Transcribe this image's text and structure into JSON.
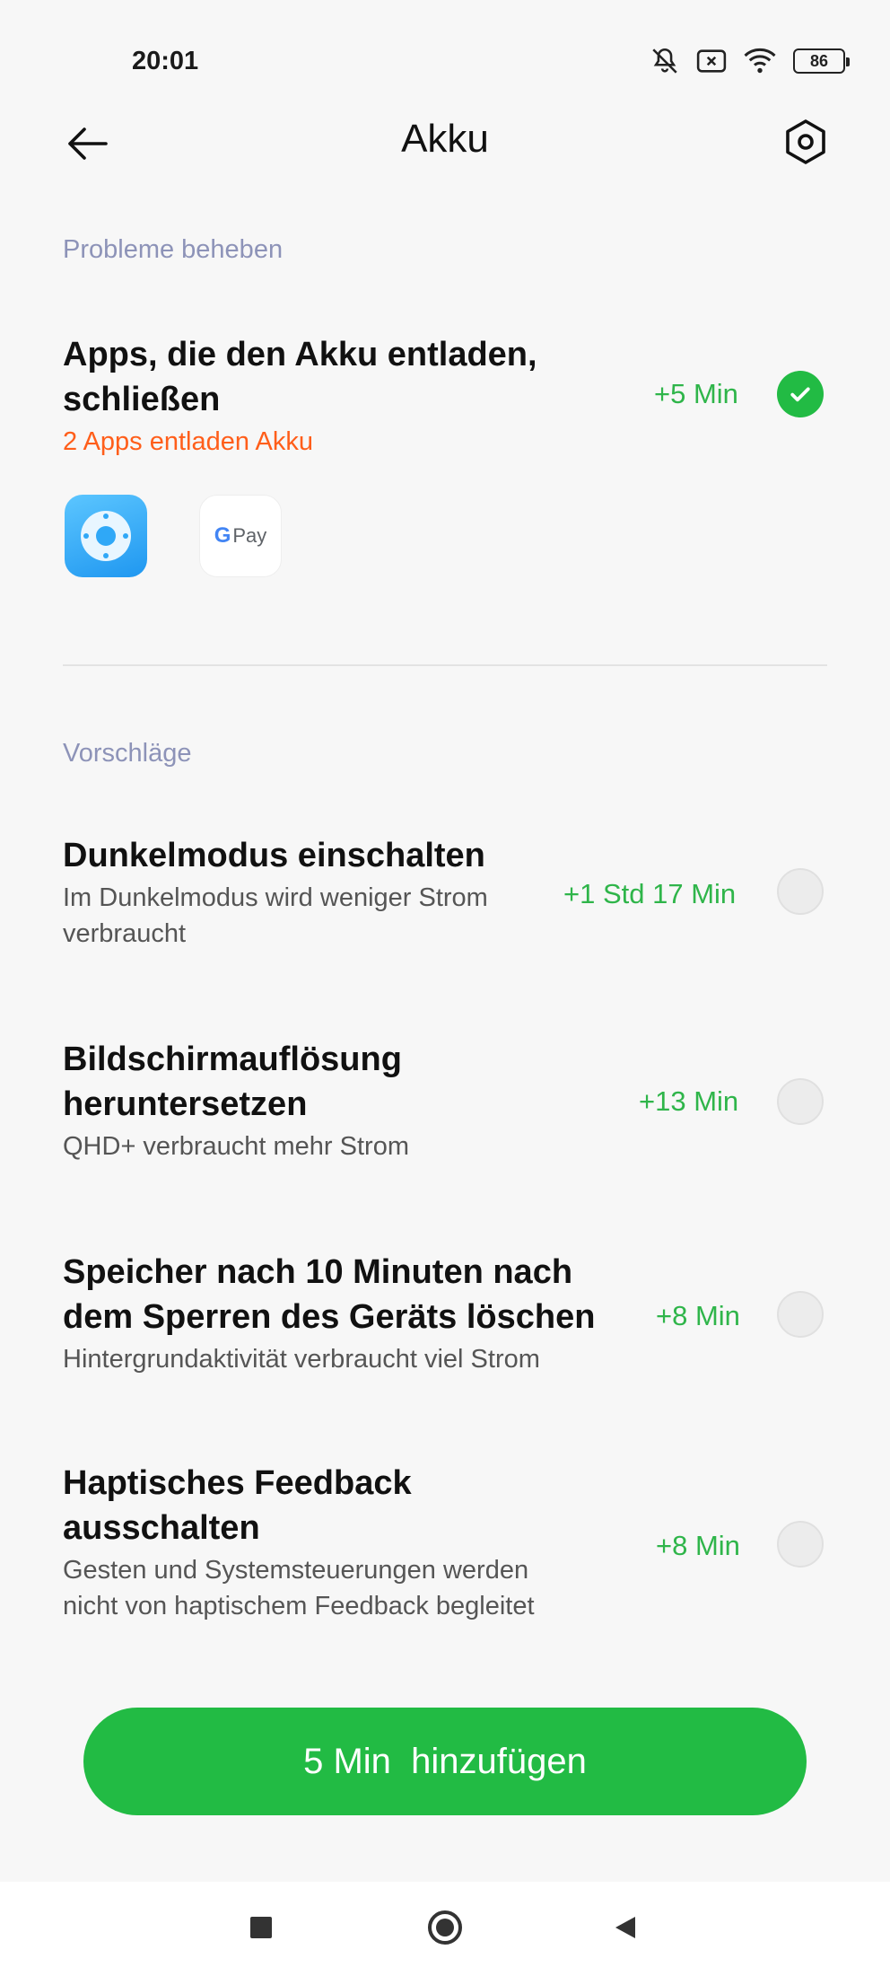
{
  "status_bar": {
    "time": "20:01",
    "battery": "86",
    "icons": [
      "mute-icon",
      "sim-off-icon",
      "wifi-icon",
      "battery-icon"
    ]
  },
  "app_bar": {
    "title": "Akku",
    "back_icon": "arrow-left-icon",
    "settings_icon": "settings-hex-icon"
  },
  "troubleshoot": {
    "header": "Probleme beheben",
    "item": {
      "title_line1": "Apps, die den Akku entladen,",
      "title_line2": "schließen",
      "subtitle": "2 Apps entladen Akku",
      "gain": "+5 Min",
      "checked": true,
      "apps": [
        {
          "name": "remote-app-icon",
          "color": "#2fa8f7"
        },
        {
          "name": "gpay-app-icon",
          "label_g": "G",
          "label_pay": "Pay"
        }
      ]
    }
  },
  "suggestions": {
    "header": "Vorschläge",
    "items": [
      {
        "title_line1": "Dunkelmodus einschalten",
        "title_line2": "",
        "subtitle_line1": "Im Dunkelmodus wird weniger Strom",
        "subtitle_line2": "verbraucht",
        "gain": "+1 Std 17 Min",
        "checked": false
      },
      {
        "title_line1": "Bildschirmauflösung",
        "title_line2": "heruntersetzen",
        "subtitle_line1": "QHD+ verbraucht mehr Strom",
        "subtitle_line2": "",
        "gain": "+13 Min",
        "checked": false
      },
      {
        "title_line1": "Speicher nach 10 Minuten nach",
        "title_line2": "dem Sperren des Geräts löschen",
        "subtitle_line1": "Hintergrundaktivität verbraucht viel Strom",
        "subtitle_line2": "",
        "gain": "+8 Min",
        "checked": false
      },
      {
        "title_line1": "Haptisches Feedback",
        "title_line2": "ausschalten",
        "subtitle_line1": "Gesten und Systemsteuerungen werden",
        "subtitle_line2": "nicht von haptischem Feedback begleitet",
        "gain": "+8 Min",
        "checked": false
      }
    ]
  },
  "action": {
    "label": "5 Min  hinzufügen"
  },
  "colors": {
    "accent": "#22bb44",
    "gain_text": "#2fb54a",
    "warning": "#ff5e1a",
    "section_header": "#8d93b8"
  },
  "nav": [
    "recents-square-icon",
    "home-circle-icon",
    "back-triangle-icon"
  ]
}
